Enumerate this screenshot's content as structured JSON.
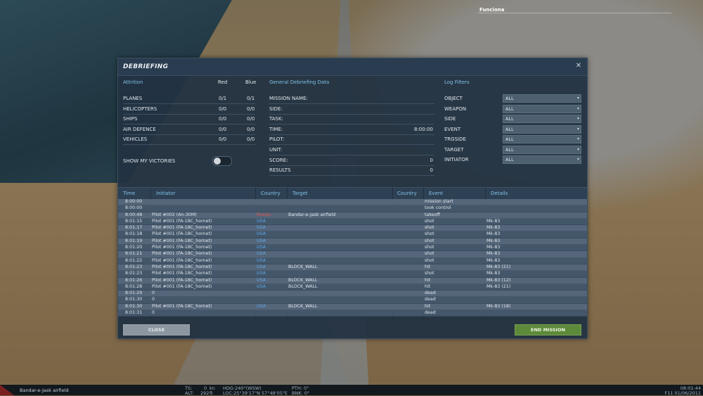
{
  "top_label": "Funciona",
  "dialog": {
    "title": "DEBRIEFING",
    "close_icon": "close-icon"
  },
  "attrition": {
    "title": "Attrition",
    "red_label": "Red",
    "blue_label": "Blue",
    "rows": [
      {
        "name": "PLANES",
        "red": "0/1",
        "blue": "0/1"
      },
      {
        "name": "HELICOPTERS",
        "red": "0/0",
        "blue": "0/0"
      },
      {
        "name": "SHIPS",
        "red": "0/0",
        "blue": "0/0"
      },
      {
        "name": "AIR DEFENCE",
        "red": "0/0",
        "blue": "0/0"
      },
      {
        "name": "VEHICLES",
        "red": "0/0",
        "blue": "0/0"
      }
    ],
    "show_victories_label": "SHOW MY VICTORIES"
  },
  "general": {
    "title": "General Debriefing Data",
    "rows": [
      {
        "label": "MISSION NAME:",
        "value": ""
      },
      {
        "label": "SIDE:",
        "value": ""
      },
      {
        "label": "TASK:",
        "value": ""
      },
      {
        "label": "TIME:",
        "value": "8:00:00"
      },
      {
        "label": "PILOT:",
        "value": ""
      },
      {
        "label": "UNIT:",
        "value": ""
      },
      {
        "label": "SCORE:",
        "value": "0"
      },
      {
        "label": "RESULTS",
        "value": "0"
      }
    ]
  },
  "filters": {
    "title": "Log Filters",
    "rows": [
      {
        "label": "OBJECT",
        "value": "ALL"
      },
      {
        "label": "WEAPON",
        "value": "ALL"
      },
      {
        "label": "SIDE",
        "value": "ALL"
      },
      {
        "label": "EVENT",
        "value": "ALL"
      },
      {
        "label": "TRGSIDE",
        "value": "ALL"
      },
      {
        "label": "TARGET",
        "value": "ALL"
      },
      {
        "label": "INITIATOR",
        "value": "ALL"
      }
    ]
  },
  "log": {
    "headers": {
      "time": "Time",
      "initiator": "Initiator",
      "country": "Country",
      "target": "Target",
      "tcountry": "Country",
      "event": "Event",
      "details": "Details"
    },
    "red_color": "#d9534f",
    "blue_color": "#5da9e9",
    "rows": [
      {
        "time": "8:00:00",
        "initiator": "",
        "country": "",
        "target": "",
        "event": "mission start",
        "details": ""
      },
      {
        "time": "8:00:00",
        "initiator": "",
        "country": "",
        "target": "",
        "event": "took control",
        "details": ""
      },
      {
        "time": "8:00:48",
        "initiator": "Pilot #002 (An-30M)",
        "country": "Russia",
        "target": "Bandar-e-Jask airfield",
        "event": "takeoff",
        "details": ""
      },
      {
        "time": "8:01:15",
        "initiator": "Pilot #001 (FA-18C_hornet)",
        "country": "USA",
        "target": "",
        "event": "shot",
        "details": "Mk-83"
      },
      {
        "time": "8:01:17",
        "initiator": "Pilot #001 (FA-18C_hornet)",
        "country": "USA",
        "target": "",
        "event": "shot",
        "details": "Mk-83"
      },
      {
        "time": "8:01:18",
        "initiator": "Pilot #001 (FA-18C_hornet)",
        "country": "USA",
        "target": "",
        "event": "shot",
        "details": "Mk-83"
      },
      {
        "time": "8:01:19",
        "initiator": "Pilot #001 (FA-18C_hornet)",
        "country": "USA",
        "target": "",
        "event": "shot",
        "details": "Mk-83"
      },
      {
        "time": "8:01:20",
        "initiator": "Pilot #001 (FA-18C_hornet)",
        "country": "USA",
        "target": "",
        "event": "shot",
        "details": "Mk-83"
      },
      {
        "time": "8:01:21",
        "initiator": "Pilot #001 (FA-18C_hornet)",
        "country": "USA",
        "target": "",
        "event": "shot",
        "details": "Mk-83"
      },
      {
        "time": "8:01:22",
        "initiator": "Pilot #001 (FA-18C_hornet)",
        "country": "USA",
        "target": "",
        "event": "shot",
        "details": "Mk-83"
      },
      {
        "time": "8:01:23",
        "initiator": "Pilot #001 (FA-18C_hornet)",
        "country": "USA",
        "target": "BLOCK_WALL",
        "event": "hit",
        "details": "Mk-83 (21)"
      },
      {
        "time": "8:01:23",
        "initiator": "Pilot #001 (FA-18C_hornet)",
        "country": "USA",
        "target": "",
        "event": "shot",
        "details": "Mk-83"
      },
      {
        "time": "8:01:26",
        "initiator": "Pilot #001 (FA-18C_hornet)",
        "country": "USA",
        "target": "BLOCK_WALL",
        "event": "hit",
        "details": "Mk-83 (12)"
      },
      {
        "time": "8:01:28",
        "initiator": "Pilot #001 (FA-18C_hornet)",
        "country": "USA",
        "target": "BLOCK_WALL",
        "event": "hit",
        "details": "Mk-83 (21)"
      },
      {
        "time": "8:01:29",
        "initiator": "0",
        "country": "",
        "target": "",
        "event": "dead",
        "details": ""
      },
      {
        "time": "8:01:30",
        "initiator": "0",
        "country": "",
        "target": "",
        "event": "dead",
        "details": ""
      },
      {
        "time": "8:01:30",
        "initiator": "Pilot #001 (FA-18C_hornet)",
        "country": "USA",
        "target": "BLOCK_WALL",
        "event": "hit",
        "details": "Mk-83 (18)"
      },
      {
        "time": "8:01:31",
        "initiator": "0",
        "country": "",
        "target": "",
        "event": "dead",
        "details": ""
      }
    ]
  },
  "buttons": {
    "close": "CLOSE",
    "end_mission": "END MISSION"
  },
  "status_bar": {
    "location": "Bandar-e-Jask airfield",
    "ts_label": "TS:",
    "ts_value": "0",
    "ts_unit": "kn",
    "alt_label": "ALT:",
    "alt_value": "292",
    "alt_unit": "ft",
    "hdg": "HDG:240°(WSW)",
    "loc": "LOC:25°39'17\"N 57°48'05\"E",
    "pth": "PTH: 0°",
    "bnk": "BNK: 0°",
    "time": "08:01:44",
    "date": "F11 01/06/2011"
  }
}
